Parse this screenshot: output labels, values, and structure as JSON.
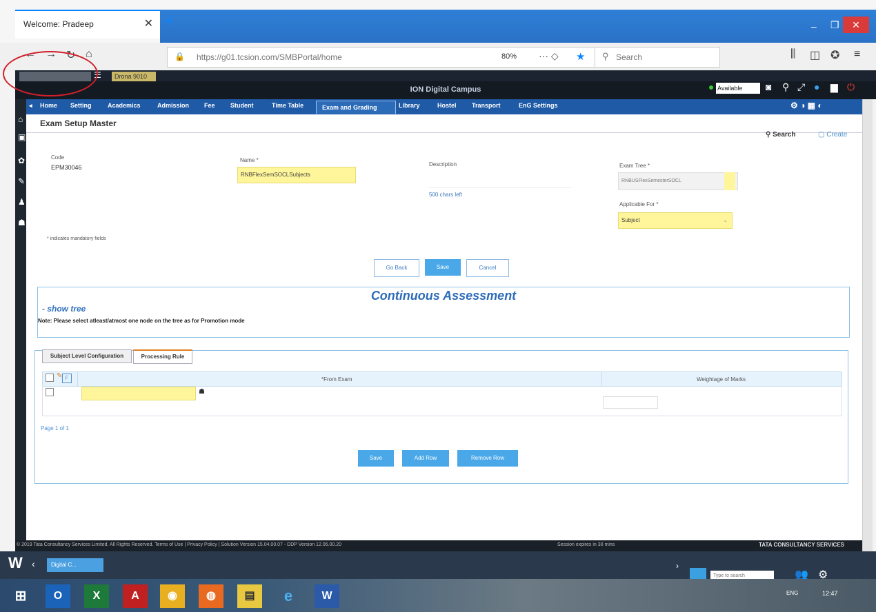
{
  "browser": {
    "tab_title": "Welcome: Pradeep",
    "tab_close": "✕",
    "new_tab": "+",
    "url": "https://g01.tcsion.com/SMBPortal/home",
    "zoom": "80%",
    "search_placeholder": "Search",
    "win_min": "–",
    "win_max": "❐",
    "win_close": "✕"
  },
  "header": {
    "role_box": "Drona 9010",
    "brand": "ION Digital Campus",
    "availability": "Available"
  },
  "main_nav": [
    "Home",
    "Setting",
    "Academics",
    "Admission",
    "Fee",
    "Student",
    "Time Table",
    "Exam and Grading",
    "Library",
    "Hostel",
    "Transport",
    "EnG Settings"
  ],
  "page": {
    "title": "Exam Setup Master",
    "search_link": "Search",
    "create_link": "Create"
  },
  "form": {
    "code_label": "Code",
    "code_value": "EPM30046",
    "name_label": "Name *",
    "name_value": "RNBFlexSemSOCLSubjects",
    "description_label": "Description",
    "chars_left": "500 chars left",
    "exam_tree_label": "Exam Tree *",
    "exam_tree_value": "RNBUSFlexSemesterSOCL",
    "applicable_label": "Applicable For *",
    "applicable_value": "Subject",
    "mandatory_note": "* indicates mandatory fields"
  },
  "actions": {
    "go_back": "Go Back",
    "save": "Save",
    "cancel": "Cancel"
  },
  "assessment": {
    "title": "Continuous Assessment",
    "show_tree": "show tree",
    "note": "Note: Please select atleast/atmost one node on the tree as for Promotion mode"
  },
  "tabs": [
    "Subject Level Configuration",
    "Processing Rule"
  ],
  "grid": {
    "col_from_exam": "*From Exam",
    "col_weightage": "Weightage of Marks",
    "pager": "Page 1 of 1"
  },
  "grid_actions": {
    "save": "Save",
    "add_row": "Add Row",
    "remove_row": "Remove Row"
  },
  "footer": {
    "left": "© 2019 Tata Consultancy Services Limited. All Rights Reserved.   Terms of Use | Privacy Policy | Solution Version 15.04.00.07 - DDP Version 12.06.00.20",
    "session": "Session expires in 30 mins",
    "brand": "TATA CONSULTANCY SERVICES"
  },
  "windows_bar": {
    "logo": "W",
    "tab": "Digital C...",
    "search_placeholder": "Type to search"
  },
  "taskbar": {
    "lang": "ENG",
    "time": "12:47"
  },
  "colors": {
    "nav_blue": "#1f5aa6",
    "accent_blue": "#4aa8e8",
    "required_yellow": "#fff59a",
    "annotation_red": "#d0202a"
  }
}
